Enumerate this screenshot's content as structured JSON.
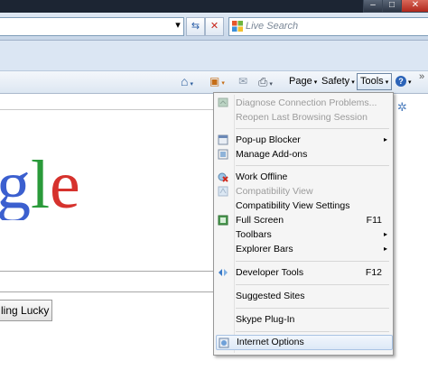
{
  "window": {
    "minimize_glyph": "–",
    "restore_glyph": "□",
    "close_glyph": "✕"
  },
  "address_bar": {
    "refresh_glyph": "⇆",
    "stop_glyph": "✕",
    "go_glyph": "▾"
  },
  "search": {
    "placeholder": "Live Search"
  },
  "command_bar": {
    "home_glyph": "⌂",
    "feeds_glyph": "▣",
    "mail_glyph": "✉",
    "print_glyph": "⎙",
    "page_label": "Page",
    "safety_label": "Safety",
    "tools_label": "Tools",
    "help_glyph": "?",
    "overflow_glyph": "»",
    "dropdown_glyph": "▾"
  },
  "page": {
    "logo_letters": [
      "g",
      "l",
      "e"
    ],
    "lucky_button": "ling Lucky",
    "gear_glyph": "✲"
  },
  "tools_menu": {
    "items": [
      {
        "label": "Diagnose Connection Problems...",
        "shortcut": "",
        "submenu": false,
        "disabled": true,
        "icon": "diagnose-icon"
      },
      {
        "label": "Reopen Last Browsing Session",
        "shortcut": "",
        "submenu": false,
        "disabled": true,
        "icon": ""
      },
      {
        "label": "Pop-up Blocker",
        "shortcut": "",
        "submenu": true,
        "disabled": false,
        "icon": "popup-blocker-icon"
      },
      {
        "label": "Manage Add-ons",
        "shortcut": "",
        "submenu": false,
        "disabled": false,
        "icon": "addons-icon"
      },
      {
        "label": "Work Offline",
        "shortcut": "",
        "submenu": false,
        "disabled": false,
        "icon": "work-offline-icon"
      },
      {
        "label": "Compatibility View",
        "shortcut": "",
        "submenu": false,
        "disabled": true,
        "icon": "compatibility-icon"
      },
      {
        "label": "Compatibility View Settings",
        "shortcut": "",
        "submenu": false,
        "disabled": false,
        "icon": ""
      },
      {
        "label": "Full Screen",
        "shortcut": "F11",
        "submenu": false,
        "disabled": false,
        "icon": "fullscreen-icon"
      },
      {
        "label": "Toolbars",
        "shortcut": "",
        "submenu": true,
        "disabled": false,
        "icon": ""
      },
      {
        "label": "Explorer Bars",
        "shortcut": "",
        "submenu": true,
        "disabled": false,
        "icon": ""
      },
      {
        "label": "Developer Tools",
        "shortcut": "F12",
        "submenu": false,
        "disabled": false,
        "icon": "developer-tools-icon"
      },
      {
        "label": "Suggested Sites",
        "shortcut": "",
        "submenu": false,
        "disabled": false,
        "icon": ""
      },
      {
        "label": "Skype Plug-In",
        "shortcut": "",
        "submenu": false,
        "disabled": false,
        "icon": ""
      },
      {
        "label": "Internet Options",
        "shortcut": "",
        "submenu": false,
        "disabled": false,
        "icon": "internet-options-icon"
      }
    ],
    "submenu_glyph": "▸"
  },
  "colors": {
    "google_blue": "#3b5fcf",
    "google_red": "#d6322d",
    "google_green": "#2a9a3a",
    "disabled_text": "#9b9b9b",
    "highlight": "#dde9f7"
  }
}
